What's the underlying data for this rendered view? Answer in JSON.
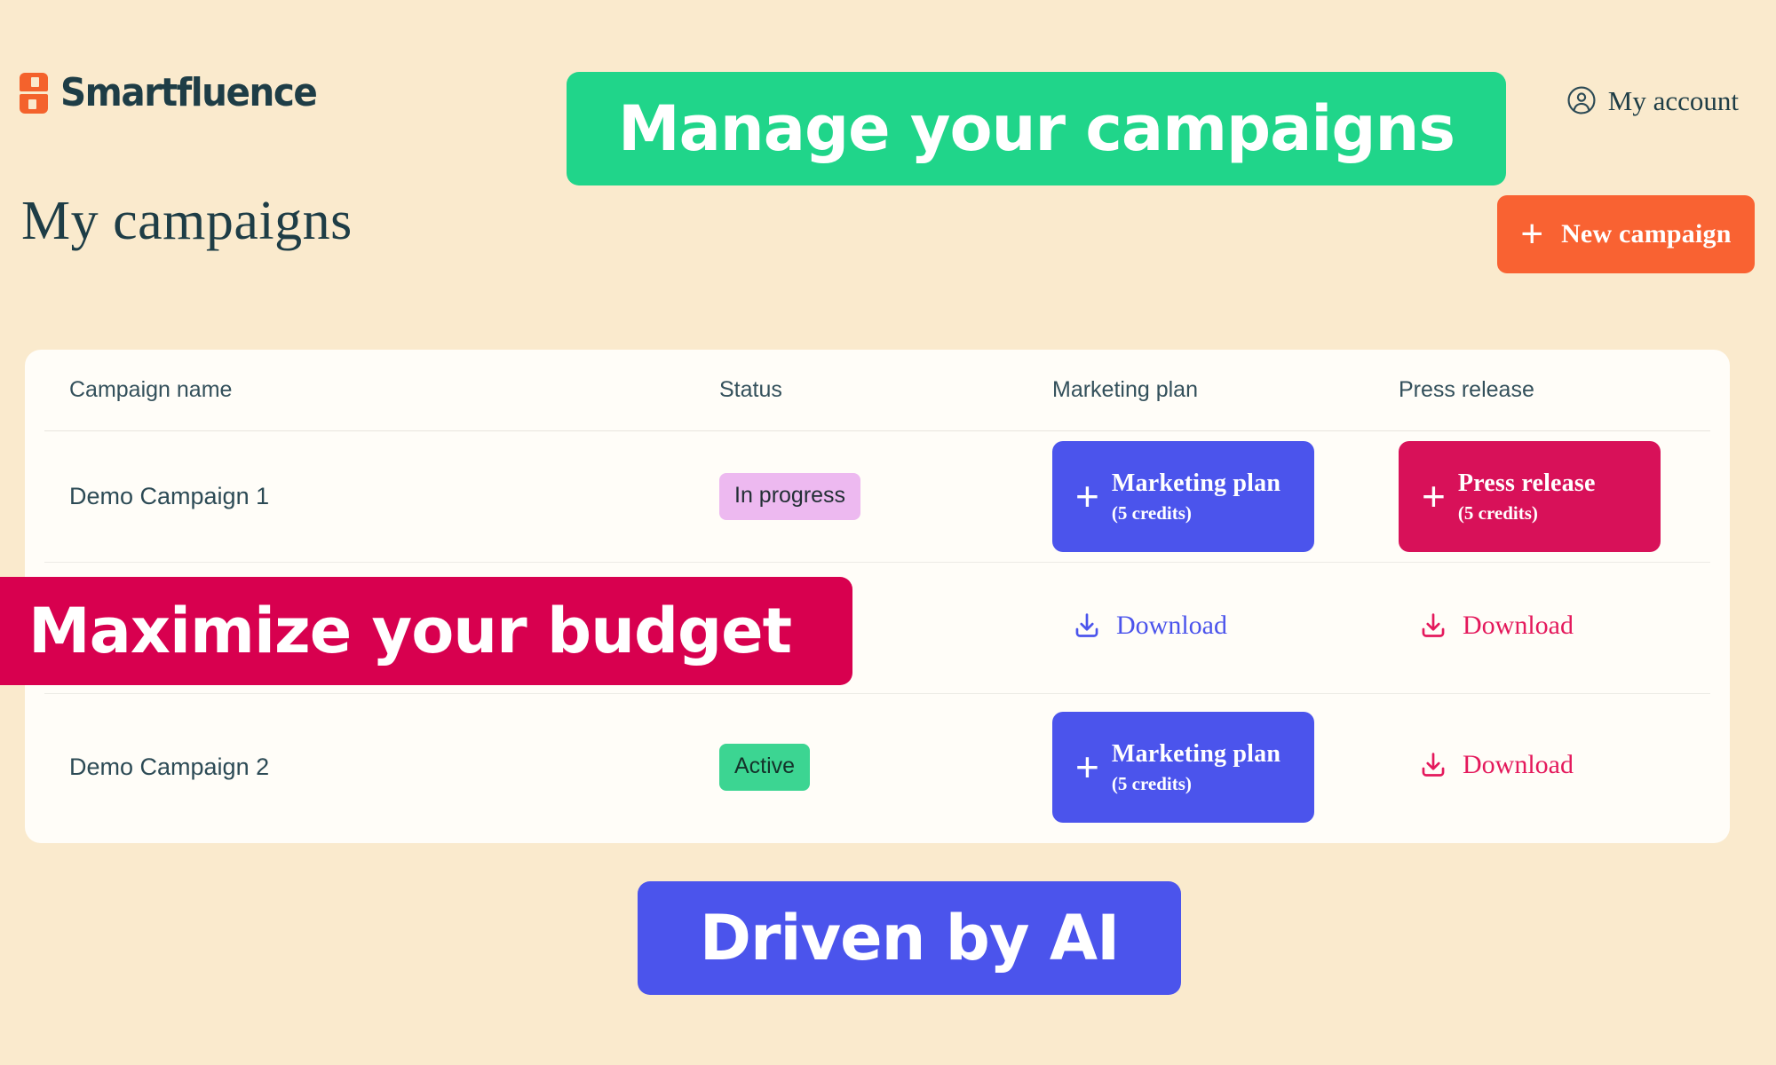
{
  "header": {
    "brand_name": "Smartfluence",
    "brand_icon": "smartfluence-logo-icon",
    "account_label": "My account",
    "account_icon": "user-circle-icon"
  },
  "page": {
    "title": "My campaigns",
    "new_campaign_label": "New campaign",
    "new_campaign_icon": "plus-icon"
  },
  "table": {
    "columns": {
      "name": "Campaign name",
      "status": "Status",
      "marketing_plan": "Marketing plan",
      "press_release": "Press release"
    },
    "rows": [
      {
        "name": "Demo Campaign 1",
        "status": "In progress",
        "status_type": "in-progress",
        "marketing_plan": {
          "type": "button",
          "label": "Marketing plan",
          "credits": "(5 credits)",
          "icon": "plus-icon"
        },
        "press_release": {
          "type": "button",
          "label": "Press release",
          "credits": "(5 credits)",
          "icon": "plus-icon"
        }
      },
      {
        "name": "",
        "status": "",
        "status_type": "",
        "marketing_plan": {
          "type": "download",
          "label": "Download",
          "icon": "download-icon"
        },
        "press_release": {
          "type": "download",
          "label": "Download",
          "icon": "download-icon"
        }
      },
      {
        "name": "Demo Campaign 2",
        "status": "Active",
        "status_type": "active",
        "marketing_plan": {
          "type": "button",
          "label": "Marketing plan",
          "credits": "(5 credits)",
          "icon": "plus-icon"
        },
        "press_release": {
          "type": "download",
          "label": "Download",
          "icon": "download-icon"
        }
      }
    ]
  },
  "banners": {
    "manage": "Manage your campaigns",
    "budget": "Maximize your budget",
    "ai": "Driven by AI"
  },
  "colors": {
    "page_background": "#faeacd",
    "card_background": "#fffdf8",
    "brand_orange": "#f4622c",
    "cta_orange": "#f96232",
    "indigo": "#4b54ec",
    "crimson": "#d81159",
    "pink_link": "#e4195c",
    "green": "#20d58a",
    "badge_active": "#3cd592",
    "badge_in_progress": "#edb9f0",
    "banner_budget": "#d8004f",
    "text_dark": "#1e3d46"
  }
}
